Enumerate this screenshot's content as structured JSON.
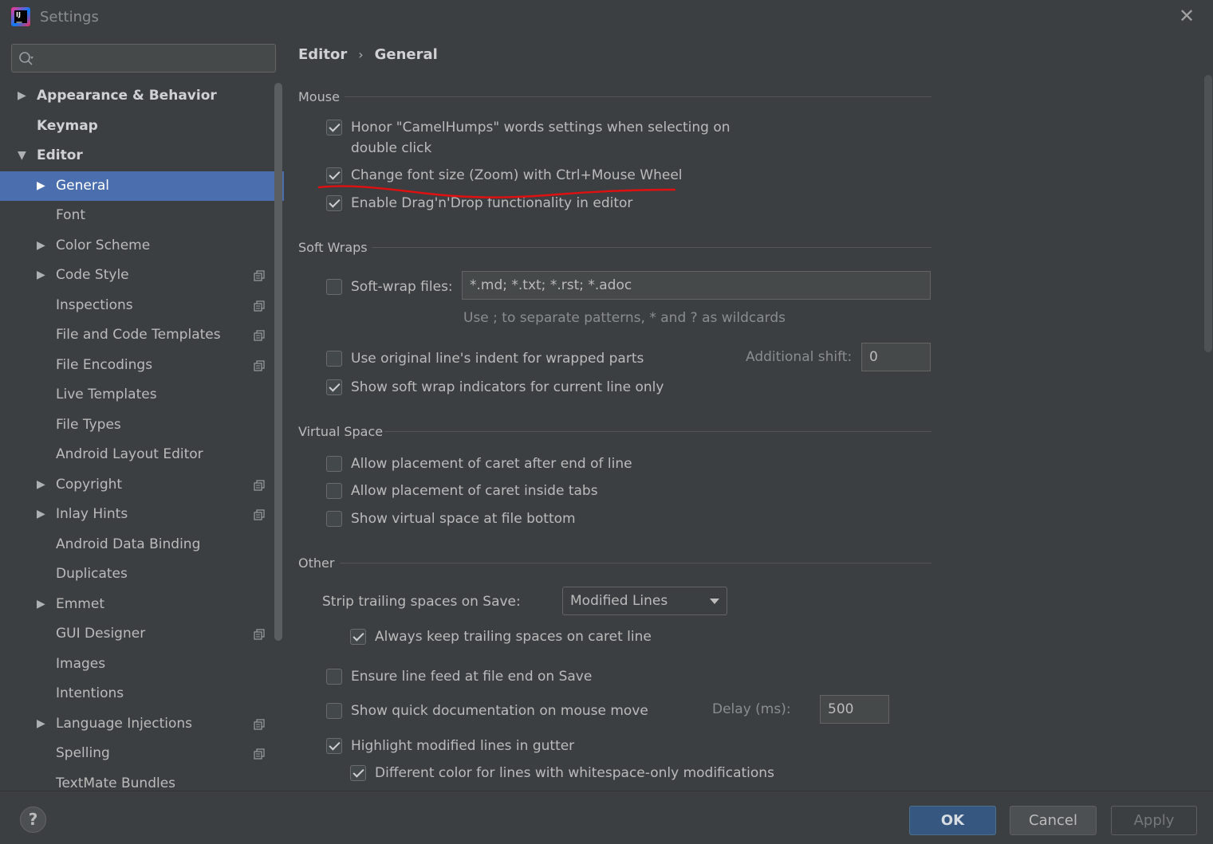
{
  "window": {
    "title": "Settings",
    "close_icon": "close-icon"
  },
  "search": {
    "placeholder": ""
  },
  "sidebar": {
    "items": [
      {
        "label": "Appearance & Behavior",
        "arrow": "▶",
        "level": 0,
        "bold": true,
        "copy": false,
        "selected": false
      },
      {
        "label": "Keymap",
        "arrow": "",
        "level": 0,
        "bold": true,
        "copy": false,
        "selected": false
      },
      {
        "label": "Editor",
        "arrow": "▼",
        "level": 0,
        "bold": true,
        "copy": false,
        "selected": false
      },
      {
        "label": "General",
        "arrow": "▶",
        "level": 1,
        "bold": false,
        "copy": false,
        "selected": true
      },
      {
        "label": "Font",
        "arrow": "",
        "level": 1,
        "bold": false,
        "copy": false,
        "selected": false
      },
      {
        "label": "Color Scheme",
        "arrow": "▶",
        "level": 1,
        "bold": false,
        "copy": false,
        "selected": false
      },
      {
        "label": "Code Style",
        "arrow": "▶",
        "level": 1,
        "bold": false,
        "copy": true,
        "selected": false
      },
      {
        "label": "Inspections",
        "arrow": "",
        "level": 1,
        "bold": false,
        "copy": true,
        "selected": false
      },
      {
        "label": "File and Code Templates",
        "arrow": "",
        "level": 1,
        "bold": false,
        "copy": true,
        "selected": false
      },
      {
        "label": "File Encodings",
        "arrow": "",
        "level": 1,
        "bold": false,
        "copy": true,
        "selected": false
      },
      {
        "label": "Live Templates",
        "arrow": "",
        "level": 1,
        "bold": false,
        "copy": false,
        "selected": false
      },
      {
        "label": "File Types",
        "arrow": "",
        "level": 1,
        "bold": false,
        "copy": false,
        "selected": false
      },
      {
        "label": "Android Layout Editor",
        "arrow": "",
        "level": 1,
        "bold": false,
        "copy": false,
        "selected": false
      },
      {
        "label": "Copyright",
        "arrow": "▶",
        "level": 1,
        "bold": false,
        "copy": true,
        "selected": false
      },
      {
        "label": "Inlay Hints",
        "arrow": "▶",
        "level": 1,
        "bold": false,
        "copy": true,
        "selected": false
      },
      {
        "label": "Android Data Binding",
        "arrow": "",
        "level": 1,
        "bold": false,
        "copy": false,
        "selected": false
      },
      {
        "label": "Duplicates",
        "arrow": "",
        "level": 1,
        "bold": false,
        "copy": false,
        "selected": false
      },
      {
        "label": "Emmet",
        "arrow": "▶",
        "level": 1,
        "bold": false,
        "copy": false,
        "selected": false
      },
      {
        "label": "GUI Designer",
        "arrow": "",
        "level": 1,
        "bold": false,
        "copy": true,
        "selected": false
      },
      {
        "label": "Images",
        "arrow": "",
        "level": 1,
        "bold": false,
        "copy": false,
        "selected": false
      },
      {
        "label": "Intentions",
        "arrow": "",
        "level": 1,
        "bold": false,
        "copy": false,
        "selected": false
      },
      {
        "label": "Language Injections",
        "arrow": "▶",
        "level": 1,
        "bold": false,
        "copy": true,
        "selected": false
      },
      {
        "label": "Spelling",
        "arrow": "",
        "level": 1,
        "bold": false,
        "copy": true,
        "selected": false
      },
      {
        "label": "TextMate Bundles",
        "arrow": "",
        "level": 1,
        "bold": false,
        "copy": false,
        "selected": false
      }
    ]
  },
  "breadcrumb": {
    "parent": "Editor",
    "separator": "›",
    "current": "General"
  },
  "mouse": {
    "title": "Mouse",
    "camelhumps_line1": "Honor \"CamelHumps\" words settings when selecting on",
    "camelhumps_line2": "double click",
    "camelhumps_checked": true,
    "zoom": "Change font size (Zoom) with Ctrl+Mouse Wheel",
    "zoom_checked": true,
    "dragdrop": "Enable Drag'n'Drop functionality in editor",
    "dragdrop_checked": true
  },
  "softwraps": {
    "title": "Soft Wraps",
    "files_label": "Soft-wrap files:",
    "files_checked": false,
    "files_value": "*.md; *.txt; *.rst; *.adoc",
    "files_hint": "Use ; to separate patterns, * and ? as wildcards",
    "indent": "Use original line's indent for wrapped parts",
    "indent_checked": false,
    "shift_label": "Additional shift:",
    "shift_value": "0",
    "indicators": "Show soft wrap indicators for current line only",
    "indicators_checked": true
  },
  "virtual": {
    "title": "Virtual Space",
    "after_eol": "Allow placement of caret after end of line",
    "after_eol_checked": false,
    "inside_tabs": "Allow placement of caret inside tabs",
    "inside_tabs_checked": false,
    "file_bottom": "Show virtual space at file bottom",
    "file_bottom_checked": false
  },
  "other": {
    "title": "Other",
    "strip_label": "Strip trailing spaces on Save:",
    "strip_value": "Modified Lines",
    "keep_caret": "Always keep trailing spaces on caret line",
    "keep_caret_checked": true,
    "line_feed": "Ensure line feed at file end on Save",
    "line_feed_checked": false,
    "quick_doc": "Show quick documentation on mouse move",
    "quick_doc_checked": false,
    "delay_label": "Delay (ms):",
    "delay_value": "500",
    "highlight": "Highlight modified lines in gutter",
    "highlight_checked": true,
    "whitespace": "Different color for lines with whitespace-only modifications",
    "whitespace_checked": true
  },
  "footer": {
    "help": "?",
    "ok": "OK",
    "cancel": "Cancel",
    "apply": "Apply"
  },
  "colors": {
    "selection": "#4b6eaf",
    "background": "#3c3f41",
    "ok_button": "#365880",
    "annotation": "#e01010"
  }
}
